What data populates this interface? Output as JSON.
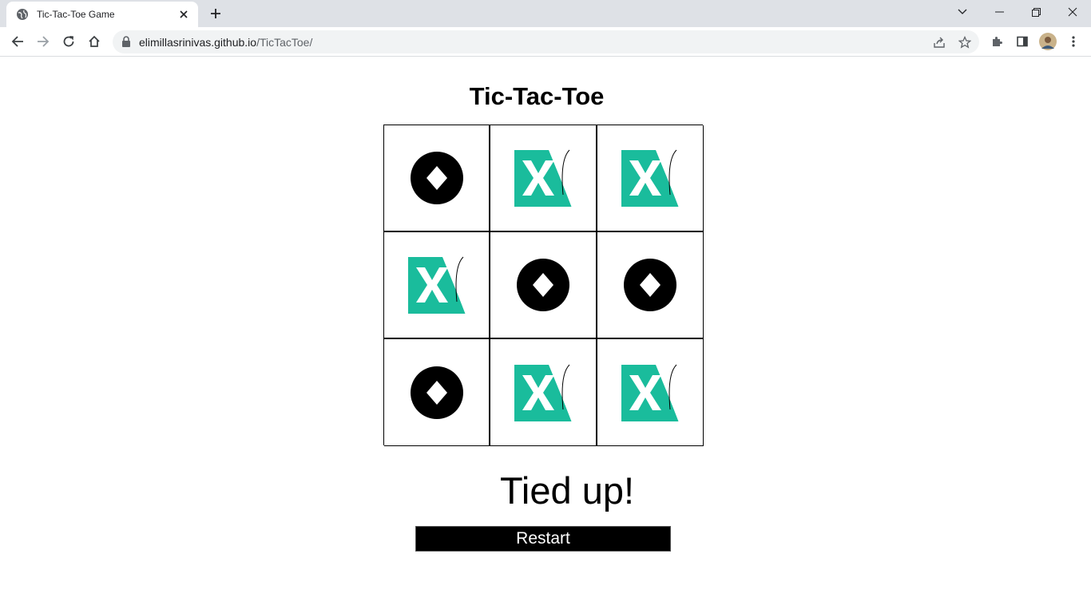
{
  "browser": {
    "tab_title": "Tic-Tac-Toe Game",
    "url_host": "elimillasrinivas.github.io",
    "url_path": "/TicTacToe/"
  },
  "game": {
    "title": "Tic-Tac-Toe",
    "board": [
      "O",
      "X",
      "X",
      "X",
      "O",
      "O",
      "O",
      "X",
      "X"
    ],
    "status": "Tied up!",
    "restart_label": "Restart",
    "colors": {
      "x_fill": "#1abc9c",
      "o_fill": "#000000"
    }
  }
}
